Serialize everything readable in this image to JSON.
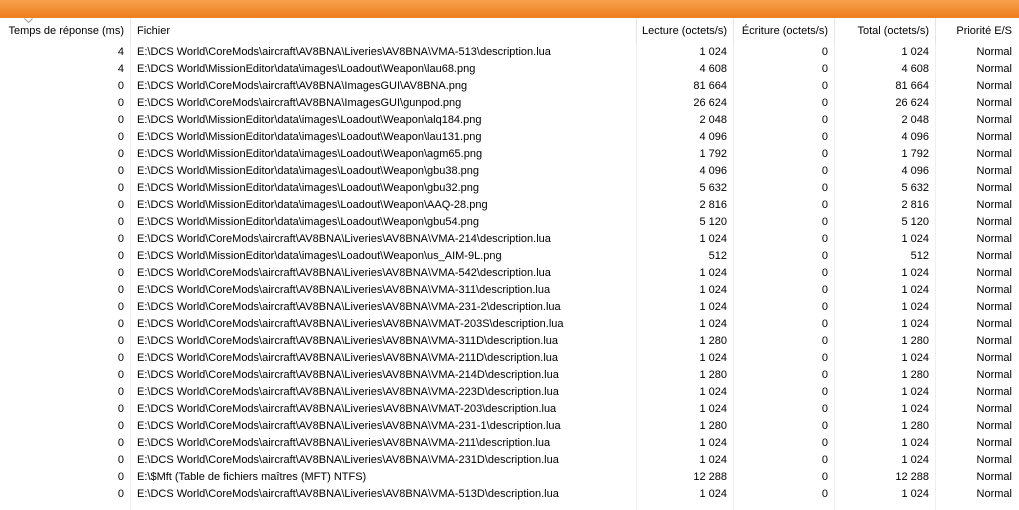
{
  "columns": [
    "Temps de réponse (ms)",
    "Fichier",
    "Lecture (octets/s)",
    "Écriture (octets/s)",
    "Total (octets/s)",
    "Priorité E/S"
  ],
  "rows": [
    [
      "4",
      "E:\\DCS World\\CoreMods\\aircraft\\AV8BNA\\Liveries\\AV8BNA\\VMA-513\\description.lua",
      "1 024",
      "0",
      "1 024",
      "Normal"
    ],
    [
      "4",
      "E:\\DCS World\\MissionEditor\\data\\images\\Loadout\\Weapon\\lau68.png",
      "4 608",
      "0",
      "4 608",
      "Normal"
    ],
    [
      "0",
      "E:\\DCS World\\CoreMods\\aircraft\\AV8BNA\\ImagesGUI\\AV8BNA.png",
      "81 664",
      "0",
      "81 664",
      "Normal"
    ],
    [
      "0",
      "E:\\DCS World\\CoreMods\\aircraft\\AV8BNA\\ImagesGUI\\gunpod.png",
      "26 624",
      "0",
      "26 624",
      "Normal"
    ],
    [
      "0",
      "E:\\DCS World\\MissionEditor\\data\\images\\Loadout\\Weapon\\alq184.png",
      "2 048",
      "0",
      "2 048",
      "Normal"
    ],
    [
      "0",
      "E:\\DCS World\\MissionEditor\\data\\images\\Loadout\\Weapon\\lau131.png",
      "4 096",
      "0",
      "4 096",
      "Normal"
    ],
    [
      "0",
      "E:\\DCS World\\MissionEditor\\data\\images\\Loadout\\Weapon\\agm65.png",
      "1 792",
      "0",
      "1 792",
      "Normal"
    ],
    [
      "0",
      "E:\\DCS World\\MissionEditor\\data\\images\\Loadout\\Weapon\\gbu38.png",
      "4 096",
      "0",
      "4 096",
      "Normal"
    ],
    [
      "0",
      "E:\\DCS World\\MissionEditor\\data\\images\\Loadout\\Weapon\\gbu32.png",
      "5 632",
      "0",
      "5 632",
      "Normal"
    ],
    [
      "0",
      "E:\\DCS World\\MissionEditor\\data\\images\\Loadout\\Weapon\\AAQ-28.png",
      "2 816",
      "0",
      "2 816",
      "Normal"
    ],
    [
      "0",
      "E:\\DCS World\\MissionEditor\\data\\images\\Loadout\\Weapon\\gbu54.png",
      "5 120",
      "0",
      "5 120",
      "Normal"
    ],
    [
      "0",
      "E:\\DCS World\\CoreMods\\aircraft\\AV8BNA\\Liveries\\AV8BNA\\VMA-214\\description.lua",
      "1 024",
      "0",
      "1 024",
      "Normal"
    ],
    [
      "0",
      "E:\\DCS World\\MissionEditor\\data\\images\\Loadout\\Weapon\\us_AIM-9L.png",
      "512",
      "0",
      "512",
      "Normal"
    ],
    [
      "0",
      "E:\\DCS World\\CoreMods\\aircraft\\AV8BNA\\Liveries\\AV8BNA\\VMA-542\\description.lua",
      "1 024",
      "0",
      "1 024",
      "Normal"
    ],
    [
      "0",
      "E:\\DCS World\\CoreMods\\aircraft\\AV8BNA\\Liveries\\AV8BNA\\VMA-311\\description.lua",
      "1 024",
      "0",
      "1 024",
      "Normal"
    ],
    [
      "0",
      "E:\\DCS World\\CoreMods\\aircraft\\AV8BNA\\Liveries\\AV8BNA\\VMA-231-2\\description.lua",
      "1 024",
      "0",
      "1 024",
      "Normal"
    ],
    [
      "0",
      "E:\\DCS World\\CoreMods\\aircraft\\AV8BNA\\Liveries\\AV8BNA\\VMAT-203S\\description.lua",
      "1 024",
      "0",
      "1 024",
      "Normal"
    ],
    [
      "0",
      "E:\\DCS World\\CoreMods\\aircraft\\AV8BNA\\Liveries\\AV8BNA\\VMA-311D\\description.lua",
      "1 280",
      "0",
      "1 280",
      "Normal"
    ],
    [
      "0",
      "E:\\DCS World\\CoreMods\\aircraft\\AV8BNA\\Liveries\\AV8BNA\\VMA-211D\\description.lua",
      "1 024",
      "0",
      "1 024",
      "Normal"
    ],
    [
      "0",
      "E:\\DCS World\\CoreMods\\aircraft\\AV8BNA\\Liveries\\AV8BNA\\VMA-214D\\description.lua",
      "1 280",
      "0",
      "1 280",
      "Normal"
    ],
    [
      "0",
      "E:\\DCS World\\CoreMods\\aircraft\\AV8BNA\\Liveries\\AV8BNA\\VMA-223D\\description.lua",
      "1 024",
      "0",
      "1 024",
      "Normal"
    ],
    [
      "0",
      "E:\\DCS World\\CoreMods\\aircraft\\AV8BNA\\Liveries\\AV8BNA\\VMAT-203\\description.lua",
      "1 024",
      "0",
      "1 024",
      "Normal"
    ],
    [
      "0",
      "E:\\DCS World\\CoreMods\\aircraft\\AV8BNA\\Liveries\\AV8BNA\\VMA-231-1\\description.lua",
      "1 280",
      "0",
      "1 280",
      "Normal"
    ],
    [
      "0",
      "E:\\DCS World\\CoreMods\\aircraft\\AV8BNA\\Liveries\\AV8BNA\\VMA-211\\description.lua",
      "1 024",
      "0",
      "1 024",
      "Normal"
    ],
    [
      "0",
      "E:\\DCS World\\CoreMods\\aircraft\\AV8BNA\\Liveries\\AV8BNA\\VMA-231D\\description.lua",
      "1 024",
      "0",
      "1 024",
      "Normal"
    ],
    [
      "0",
      "E:\\$Mft (Table de fichiers maîtres (MFT) NTFS)",
      "12 288",
      "0",
      "12 288",
      "Normal"
    ],
    [
      "0",
      "E:\\DCS World\\CoreMods\\aircraft\\AV8BNA\\Liveries\\AV8BNA\\VMA-513D\\description.lua",
      "1 024",
      "0",
      "1 024",
      "Normal"
    ]
  ],
  "sort": {
    "column_index": 0,
    "icon": "sort-descending-icon"
  },
  "colors": {
    "title_bar": "#ee7e1c",
    "grid_line": "#f0f0f0"
  }
}
